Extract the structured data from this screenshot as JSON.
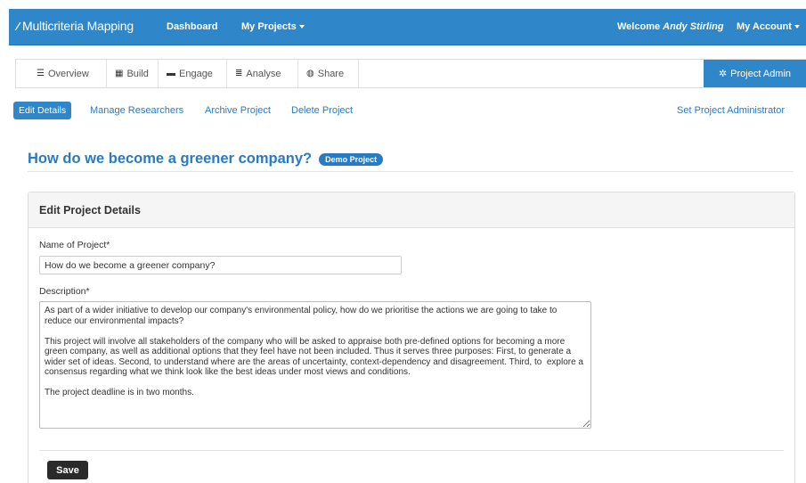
{
  "navbar": {
    "brand": "Multicriteria Mapping",
    "brand_icon": "⁄",
    "dashboard": "Dashboard",
    "my_projects": "My Projects",
    "welcome_prefix": "Welcome ",
    "welcome_user": "Andy Stirling",
    "my_account": "My Account"
  },
  "tabs": [
    {
      "label": "Overview",
      "icon": "list-icon"
    },
    {
      "label": "Build",
      "icon": "grid-icon"
    },
    {
      "label": "Engage",
      "icon": "comment-icon"
    },
    {
      "label": "Analyse",
      "icon": "align-icon"
    },
    {
      "label": "Share",
      "icon": "globe-icon"
    }
  ],
  "project_admin": "Project Admin",
  "subnav": {
    "edit_details": "Edit Details",
    "manage_researchers": "Manage Researchers",
    "archive_project": "Archive Project",
    "delete_project": "Delete Project",
    "set_admin": "Set Project Administrator"
  },
  "page": {
    "title": "How do we become a greener company?",
    "badge": "Demo Project"
  },
  "panel": {
    "heading": "Edit Project Details",
    "name_label": "Name of Project*",
    "name_value": "How do we become a greener company?",
    "description_label": "Description*",
    "description_value": "As part of a wider initiative to develop our company's environmental policy, how do we prioritise the actions we are going to take to reduce our environmental impacts?\n\nThis project will involve all stakeholders of the company who will be asked to appraise both pre-defined options for becoming a more green company, as well as additional options that they feel have not been included. Thus it serves three purposes: First, to generate a wider set of ideas. Second, to understand where are the areas of uncertainty, context-dependency and disagreement. Third, to  explore a consensus regarding what we think look like the best ideas under most views and conditions.\n\nThe project deadline is in two months.",
    "save": "Save"
  }
}
